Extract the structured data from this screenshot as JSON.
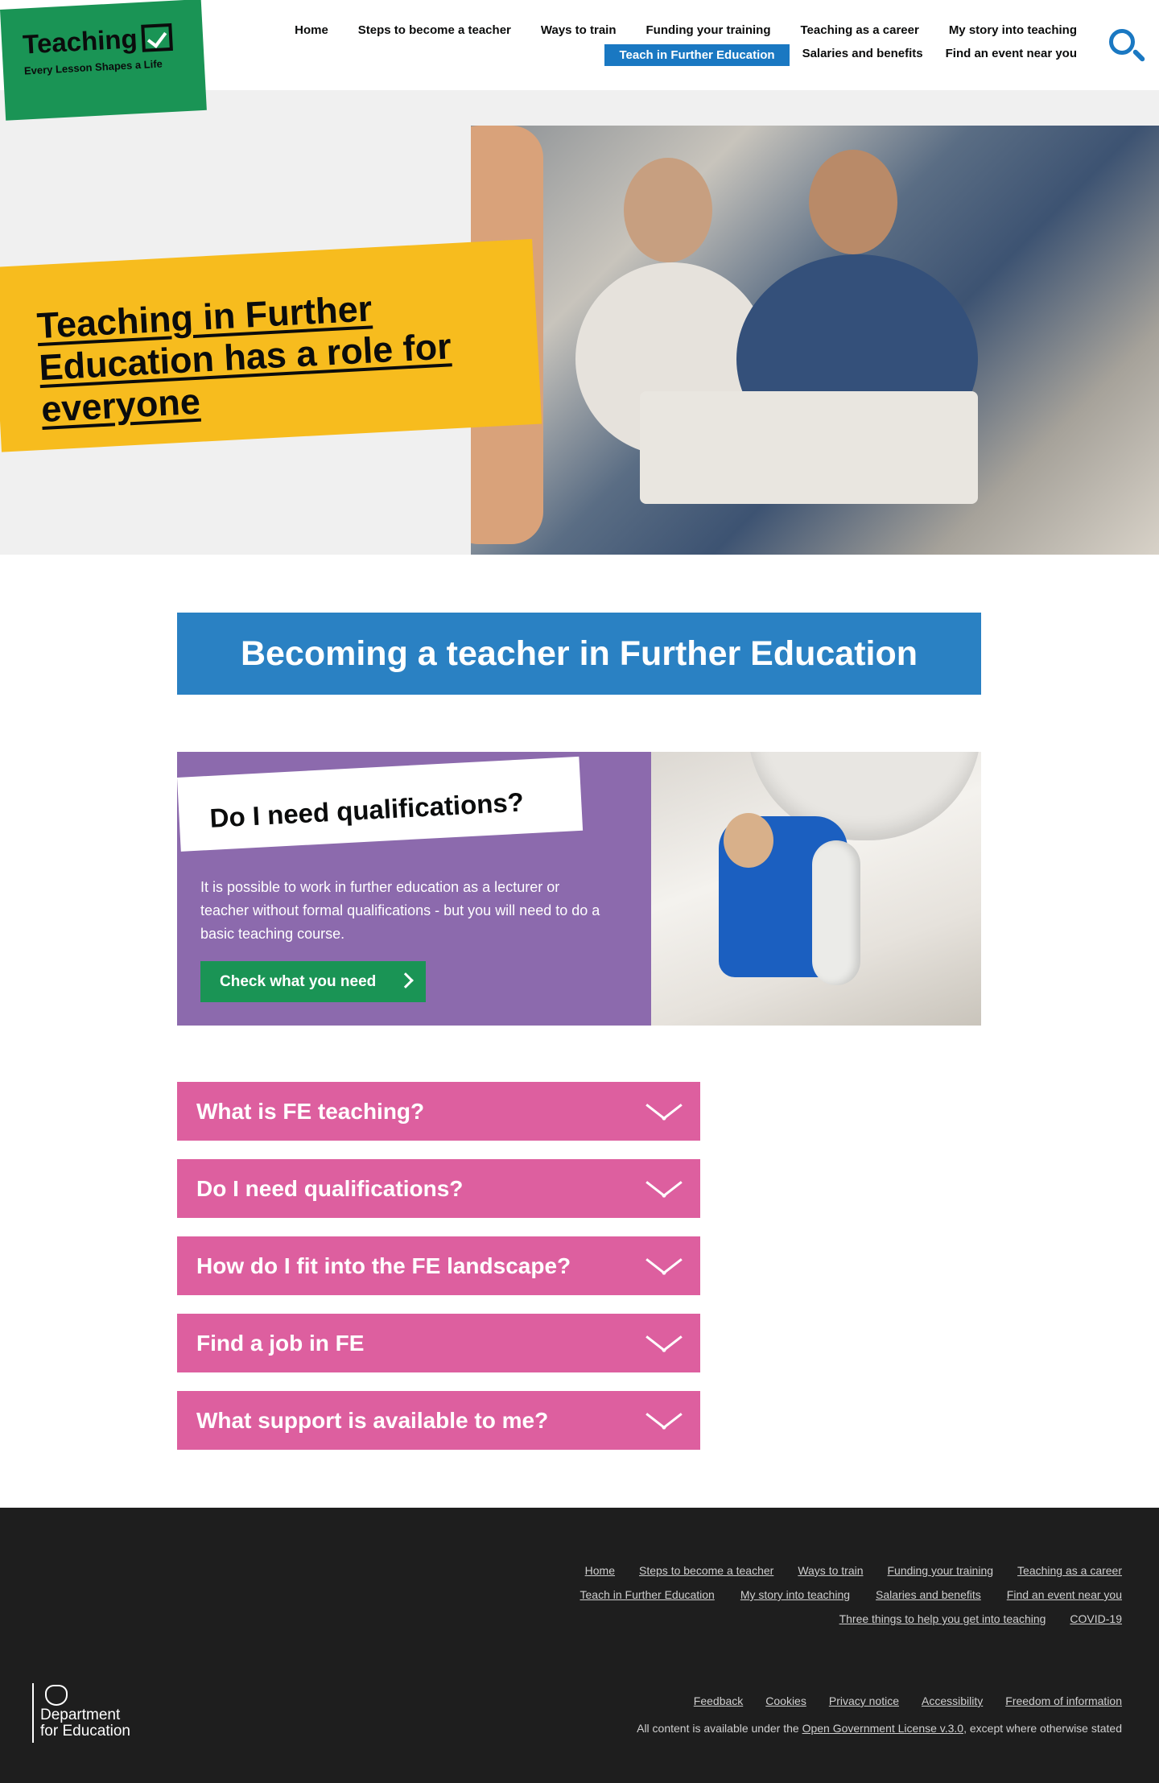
{
  "logo": {
    "word": "Teaching",
    "tagline": "Every Lesson Shapes a Life"
  },
  "nav": {
    "row1": [
      "Home",
      "Steps to become a teacher",
      "Ways to train",
      "Funding your training",
      "Teaching as a career",
      "My story into teaching"
    ],
    "row2": [
      "Teach in Further Education",
      "Salaries and benefits",
      "Find an event near you"
    ]
  },
  "hero": {
    "heading": "Teaching in Further Education has a role for everyone"
  },
  "main": {
    "title": "Becoming a teacher in Further Education",
    "card": {
      "heading": "Do I need qualifications?",
      "text": "It is possible to work in further education as a lecturer or teacher without formal qualifications - but you will need to do a basic teaching course.",
      "button": "Check what you need"
    },
    "accordion": [
      "What is FE teaching?",
      "Do I need qualifications?",
      "How do I fit into the FE landscape?",
      "Find a job in FE",
      "What support is available to me?"
    ]
  },
  "footer": {
    "links_row1": [
      "Home",
      "Steps to become a teacher",
      "Ways to train",
      "Funding your training",
      "Teaching as a career"
    ],
    "links_row2": [
      "Teach in Further Education",
      "My story into teaching",
      "Salaries and benefits",
      "Find an event near you"
    ],
    "links_row3": [
      "Three things to help you get into teaching",
      "COVID-19"
    ],
    "bottom_links": [
      "Feedback",
      "Cookies",
      "Privacy notice",
      "Accessibility",
      "Freedom of information"
    ],
    "license_prefix": "All content is available under the",
    "license_link": "Open Government License v.3.0,",
    "license_suffix": "except where otherwise stated",
    "dfe_line1": "Department",
    "dfe_line2": "for Education"
  },
  "colors": {
    "green": "#1a9455",
    "blue": "#2a81c3",
    "yellow": "#f7bc1e",
    "purple": "#8c6aad",
    "pink": "#dd5f9f",
    "footer": "#1e1e1e"
  }
}
